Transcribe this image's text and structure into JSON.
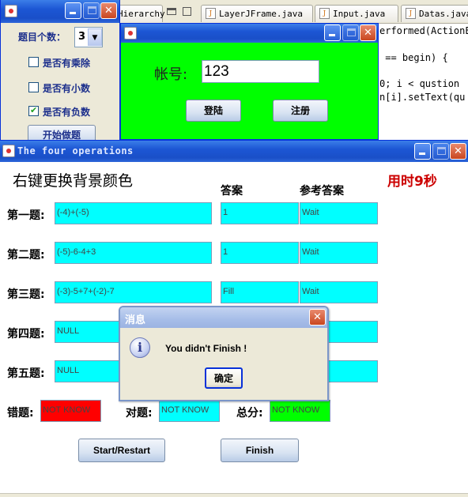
{
  "ide": {
    "tabs": [
      {
        "label": "Hierarchy"
      },
      {
        "label": "LayerJFrame.java"
      },
      {
        "label": "Input.java"
      },
      {
        "label": "Datas.java"
      }
    ],
    "code_lines": [
      "erformed(ActionE",
      " == begin) {",
      "0; i < qustion",
      "n[i].setText(qu"
    ]
  },
  "settings_window": {
    "question_count_label": "题目个数：",
    "question_count_value": "3",
    "checkboxes": [
      {
        "label": "是否有乘除",
        "checked": false
      },
      {
        "label": "是否有小数",
        "checked": false
      },
      {
        "label": "是否有负数",
        "checked": true
      }
    ],
    "start_button_label": "开始做题"
  },
  "login_window": {
    "account_label": "帐号:",
    "account_value": "123",
    "login_button": "登陆",
    "register_button": "注册",
    "background_color": "#00ff00"
  },
  "main_window": {
    "title": "The four operations",
    "hint": "右键更换背景颜色",
    "timer": "用时9秒",
    "answer_header": "答案",
    "ref_answer_header": "参考答案",
    "questions": [
      {
        "label": "第一题:",
        "expression": "(-4)+(-5)",
        "answer": "1",
        "reference": "Wait"
      },
      {
        "label": "第二题:",
        "expression": "(-5)-6-4+3",
        "answer": "1",
        "reference": "Wait"
      },
      {
        "label": "第三题:",
        "expression": "(-3)-5+7+(-2)-7",
        "answer": "Fill",
        "reference": "Wait"
      },
      {
        "label": "第四题:",
        "expression": "NULL",
        "answer": "",
        "reference": ""
      },
      {
        "label": "第五题:",
        "expression": "NULL",
        "answer": "",
        "reference": ""
      }
    ],
    "wrong_label": "错题:",
    "wrong_value": "NOT KNOW",
    "right_label": "对题:",
    "right_value": "NOT KNOW",
    "total_label": "总分:",
    "total_value": "NOT KNOW",
    "start_restart_button": "Start/Restart",
    "finish_button": "Finish",
    "colors": {
      "field": "#00ffff",
      "wrong": "#ff0000",
      "total": "#00ff00",
      "timer": "#cc0000"
    }
  },
  "dialog": {
    "title": "消息",
    "message": "You didn't Finish !",
    "ok_button": "确定",
    "icon": "info-icon"
  }
}
